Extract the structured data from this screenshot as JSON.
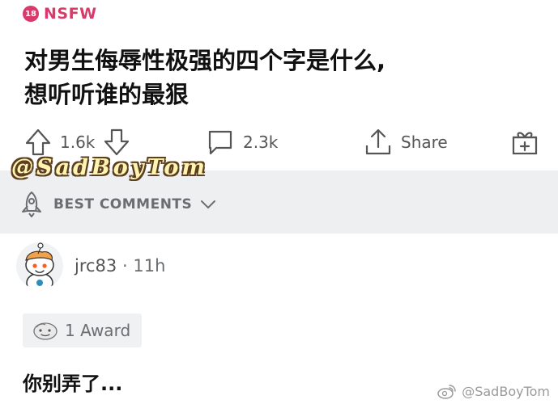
{
  "post": {
    "nsfw_badge": "18",
    "nsfw_label": "NSFW",
    "title_line1": "对男生侮辱性极强的四个字是什么,",
    "title_line2": "想听听谁的最狠"
  },
  "actions": {
    "upvotes": "1.6k",
    "comments": "2.3k",
    "share_label": "Share"
  },
  "overlay_watermark": "@SadBoyTom",
  "sort": {
    "label": "BEST COMMENTS"
  },
  "comment": {
    "username": "jrc83",
    "separator": "·",
    "age": "11h",
    "award_label": "1 Award",
    "text": "你别弄了..."
  },
  "footer_watermark": "@SadBoyTom",
  "colors": {
    "nsfw": "#d93a6b",
    "sort_bar_bg": "#edeff1",
    "icon_gray": "#555555"
  },
  "icons": [
    "upvote-icon",
    "downvote-icon",
    "comment-icon",
    "share-icon",
    "gift-icon",
    "rocket-icon",
    "chevron-down-icon",
    "avatar-icon",
    "award-icon",
    "weibo-icon"
  ]
}
